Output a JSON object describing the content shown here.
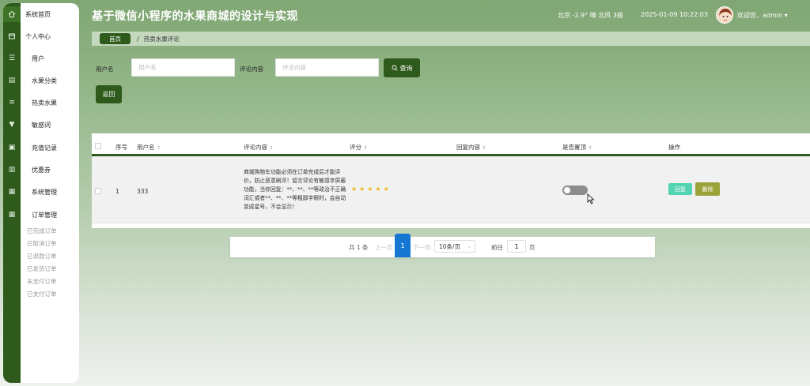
{
  "app": {
    "title": "基于微信小程序的水果商城的设计与实现"
  },
  "header": {
    "weather": "北京  -2.9° 晴  北风  3级",
    "datetime": "2025-01-09 10:22:03",
    "welcome": "欢迎您，admin",
    "caret": "▾"
  },
  "sidebar": {
    "items": [
      {
        "label": "系统首页",
        "icon": "home-icon"
      },
      {
        "label": "个人中心",
        "icon": "user-card-icon"
      },
      {
        "label": "用户",
        "icon": "sliders-icon"
      },
      {
        "label": "水果分类",
        "icon": "database-icon"
      },
      {
        "label": "热卖水果",
        "icon": "list-icon"
      },
      {
        "label": "敏感词",
        "icon": "filter-icon"
      },
      {
        "label": "充值记录",
        "icon": "briefcase-icon"
      },
      {
        "label": "优惠券",
        "icon": "clipboard-icon"
      },
      {
        "label": "系统管理",
        "icon": "grid-icon"
      },
      {
        "label": "订单管理",
        "icon": "grid-icon"
      }
    ],
    "order_sub": [
      "已完成订单",
      "已取消订单",
      "已退款订单",
      "已发货订单",
      "未支付订单",
      "已支付订单"
    ]
  },
  "breadcrumb": {
    "home": "首页",
    "separator": "/",
    "current": "热卖水果评论"
  },
  "search": {
    "username_label": "用户名",
    "username_placeholder": "用户名",
    "comment_label": "评论内容",
    "comment_placeholder": "评论内容",
    "search_button": "查询",
    "back_button": "返回"
  },
  "table": {
    "columns": [
      "序号",
      "用户名",
      "评论内容",
      "评分",
      "回复内容",
      "是否置顶",
      "操作"
    ],
    "rows": [
      {
        "index": "1",
        "username": "333",
        "comment": "商城购物车功能必须在订单完成后才能评价，防止恶意刷评！留言评论有敏感字屏蔽功能，当你回复：**、**、**等政治不正确词汇或者**、**、**等粗鄙字眼时，会自动变成星号，不会显示！",
        "rating": 5,
        "stars": "★★★★★",
        "reply": "",
        "pinned": false,
        "actions": {
          "reply": "回复",
          "delete": "删除"
        }
      }
    ]
  },
  "pagination": {
    "total": "共 1 条",
    "prev": "上一页",
    "current": "1",
    "next": "下一页",
    "page_size": "10条/页",
    "goto_label": "前往",
    "goto_value": "1",
    "page_unit": "页"
  },
  "colors": {
    "primary": "#2e5a1c",
    "page_active": "#1677d2",
    "star": "#f0b51a",
    "reply_btn": "#52d3b2",
    "delete_btn": "#9aa23a"
  }
}
